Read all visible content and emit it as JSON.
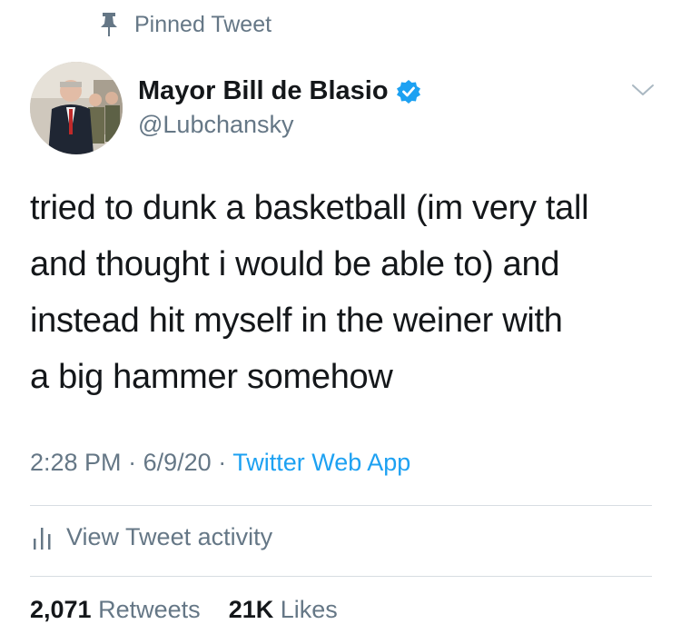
{
  "pinned_label": "Pinned Tweet",
  "author": {
    "display_name": "Mayor Bill de Blasio",
    "handle": "@Lubchansky",
    "verified": true
  },
  "tweet": {
    "text": "tried to dunk a basketball (im very tall\nand thought i would be able to) and\ninstead hit myself in the weiner with\na big hammer somehow",
    "time": "2:28 PM",
    "separator": "·",
    "date": "6/9/20",
    "source": "Twitter Web App"
  },
  "activity_label": "View Tweet activity",
  "stats": {
    "retweets_count": "2,071",
    "retweets_label": "Retweets",
    "likes_count": "21K",
    "likes_label": "Likes"
  },
  "colors": {
    "accent": "#1da1f2",
    "muted_text": "#657786",
    "primary_text": "#14171a",
    "divider": "#d7dde2"
  },
  "icons": [
    "pin-icon",
    "verified-badge-icon",
    "chevron-down-icon",
    "bar-chart-icon"
  ]
}
